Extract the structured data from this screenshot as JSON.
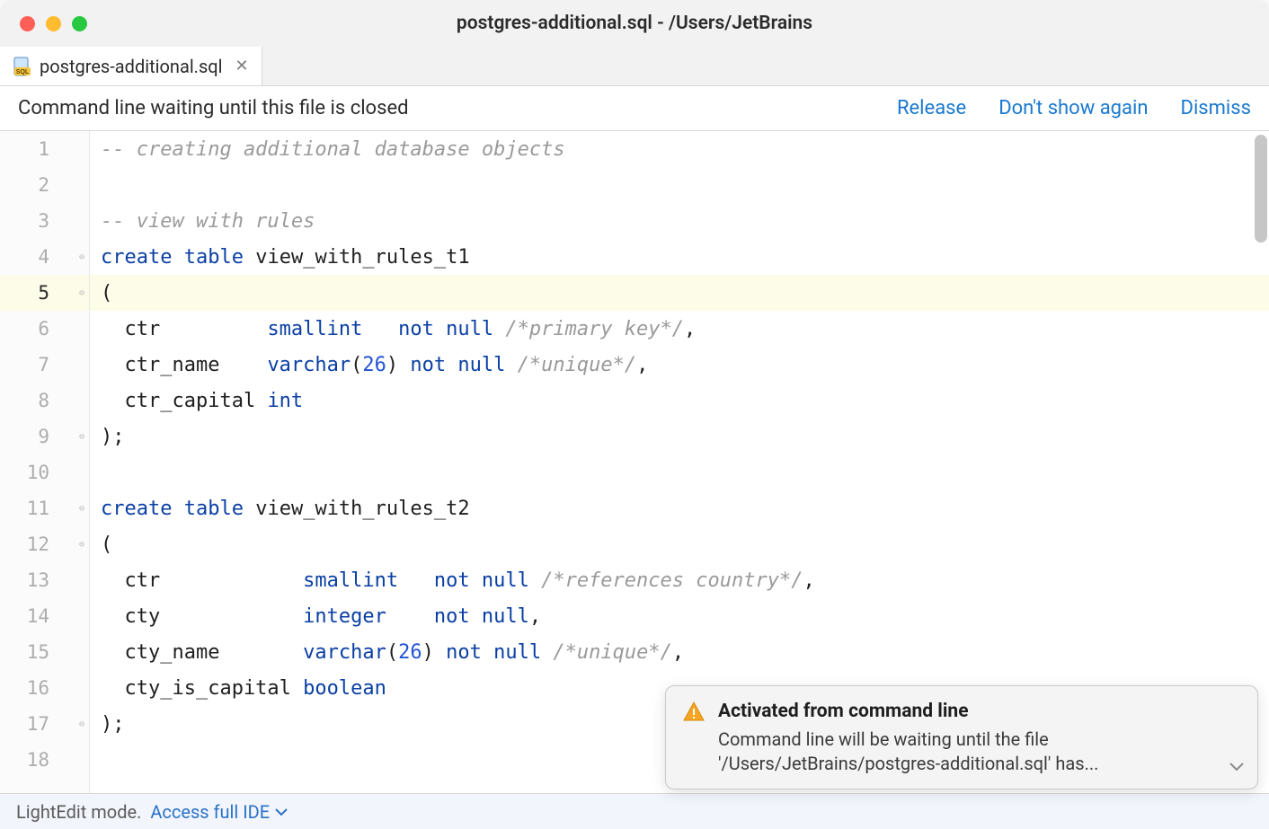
{
  "window": {
    "title": "postgres-additional.sql - /Users/JetBrains"
  },
  "tab": {
    "filename": "postgres-additional.sql"
  },
  "notification_bar": {
    "message": "Command line waiting until this file is closed",
    "release": "Release",
    "dont_show": "Don't show again",
    "dismiss": "Dismiss"
  },
  "editor": {
    "line_count": 18,
    "current_line": 5,
    "fold_lines": [
      4,
      5,
      9,
      11,
      12,
      17
    ],
    "lines": [
      [
        {
          "t": "comment",
          "v": "-- creating additional database objects"
        }
      ],
      [],
      [
        {
          "t": "comment",
          "v": "-- view with rules"
        }
      ],
      [
        {
          "t": "kw",
          "v": "create"
        },
        {
          "t": "text",
          "v": " "
        },
        {
          "t": "kw",
          "v": "table "
        },
        {
          "t": "text",
          "v": "view_with_rules_t1"
        }
      ],
      [
        {
          "t": "text",
          "v": "("
        }
      ],
      [
        {
          "t": "text",
          "v": "  ctr         "
        },
        {
          "t": "kw",
          "v": "smallint   not null "
        },
        {
          "t": "comment",
          "v": "/*primary key*/"
        },
        {
          "t": "text",
          "v": ","
        }
      ],
      [
        {
          "t": "text",
          "v": "  ctr_name    "
        },
        {
          "t": "kw",
          "v": "varchar"
        },
        {
          "t": "text",
          "v": "("
        },
        {
          "t": "num",
          "v": "26"
        },
        {
          "t": "text",
          "v": ") "
        },
        {
          "t": "kw",
          "v": "not null "
        },
        {
          "t": "comment",
          "v": "/*unique*/"
        },
        {
          "t": "text",
          "v": ","
        }
      ],
      [
        {
          "t": "text",
          "v": "  ctr_capital "
        },
        {
          "t": "kw",
          "v": "int"
        }
      ],
      [
        {
          "t": "text",
          "v": ");"
        }
      ],
      [],
      [
        {
          "t": "kw",
          "v": "create"
        },
        {
          "t": "text",
          "v": " "
        },
        {
          "t": "kw",
          "v": "table "
        },
        {
          "t": "text",
          "v": "view_with_rules_t2"
        }
      ],
      [
        {
          "t": "text",
          "v": "("
        }
      ],
      [
        {
          "t": "text",
          "v": "  ctr            "
        },
        {
          "t": "kw",
          "v": "smallint   not null "
        },
        {
          "t": "comment",
          "v": "/*references country*/"
        },
        {
          "t": "text",
          "v": ","
        }
      ],
      [
        {
          "t": "text",
          "v": "  cty            "
        },
        {
          "t": "kw",
          "v": "integer    not null"
        },
        {
          "t": "text",
          "v": ","
        }
      ],
      [
        {
          "t": "text",
          "v": "  cty_name       "
        },
        {
          "t": "kw",
          "v": "varchar"
        },
        {
          "t": "text",
          "v": "("
        },
        {
          "t": "num",
          "v": "26"
        },
        {
          "t": "text",
          "v": ") "
        },
        {
          "t": "kw",
          "v": "not null "
        },
        {
          "t": "comment",
          "v": "/*unique*/"
        },
        {
          "t": "text",
          "v": ","
        }
      ],
      [
        {
          "t": "text",
          "v": "  cty_is_capital "
        },
        {
          "t": "kw",
          "v": "boolean"
        }
      ],
      [
        {
          "t": "text",
          "v": ");"
        }
      ],
      []
    ]
  },
  "statusbar": {
    "mode": "LightEdit mode.",
    "access": "Access full IDE"
  },
  "popup": {
    "title": "Activated from command line",
    "text": "Command line will be waiting until the file '/Users/JetBrains/postgres-additional.sql' has..."
  }
}
